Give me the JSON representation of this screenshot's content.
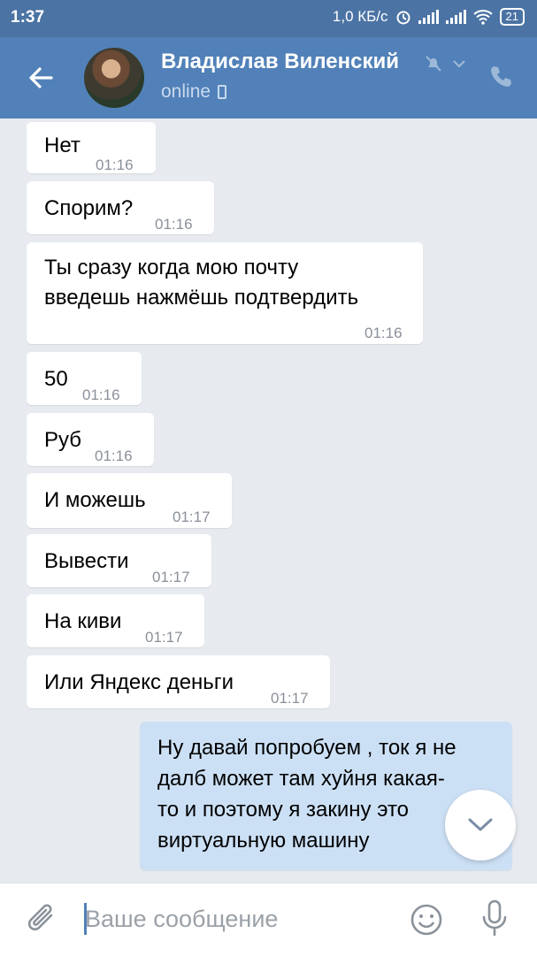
{
  "statusbar": {
    "time": "1:37",
    "speed": "1,0 КБ/с",
    "battery": "21"
  },
  "header": {
    "name": "Владислав Виленский",
    "status": "online"
  },
  "messages": [
    {
      "text": "Нет",
      "time": "01:16"
    },
    {
      "text": "Спорим?",
      "time": "01:16"
    },
    {
      "line1": "Ты сразу когда мою почту",
      "line2": "введешь нажмёшь подтвердить",
      "time": "01:16"
    },
    {
      "text": "50",
      "time": "01:16"
    },
    {
      "text": "Руб",
      "time": "01:16"
    },
    {
      "text": "И можешь",
      "time": "01:17"
    },
    {
      "text": "Вывести",
      "time": "01:17"
    },
    {
      "text": "На киви",
      "time": "01:17"
    },
    {
      "text": "Или Яндекс деньги",
      "time": "01:17"
    }
  ],
  "outgoing": {
    "line1": "Ну давай попробуем , ток я не",
    "line2": "далб может там хуйня какая-",
    "line3": "то и поэтому я закину это",
    "line4": "виртуальную машину"
  },
  "input": {
    "placeholder": "Ваше сообщение"
  },
  "icons": {
    "back": "arrow-left-icon",
    "mute": "muted-bell-icon",
    "chevron": "chevron-down-icon",
    "call": "phone-icon",
    "attach": "paperclip-icon",
    "emoji": "smile-icon",
    "mic": "microphone-icon",
    "scroll": "scroll-down-icon"
  },
  "colors": {
    "header": "#5181b8",
    "statusbar": "#4b73a4",
    "outgoing_bubble": "#cce0f5",
    "background": "#e7ebf0"
  }
}
